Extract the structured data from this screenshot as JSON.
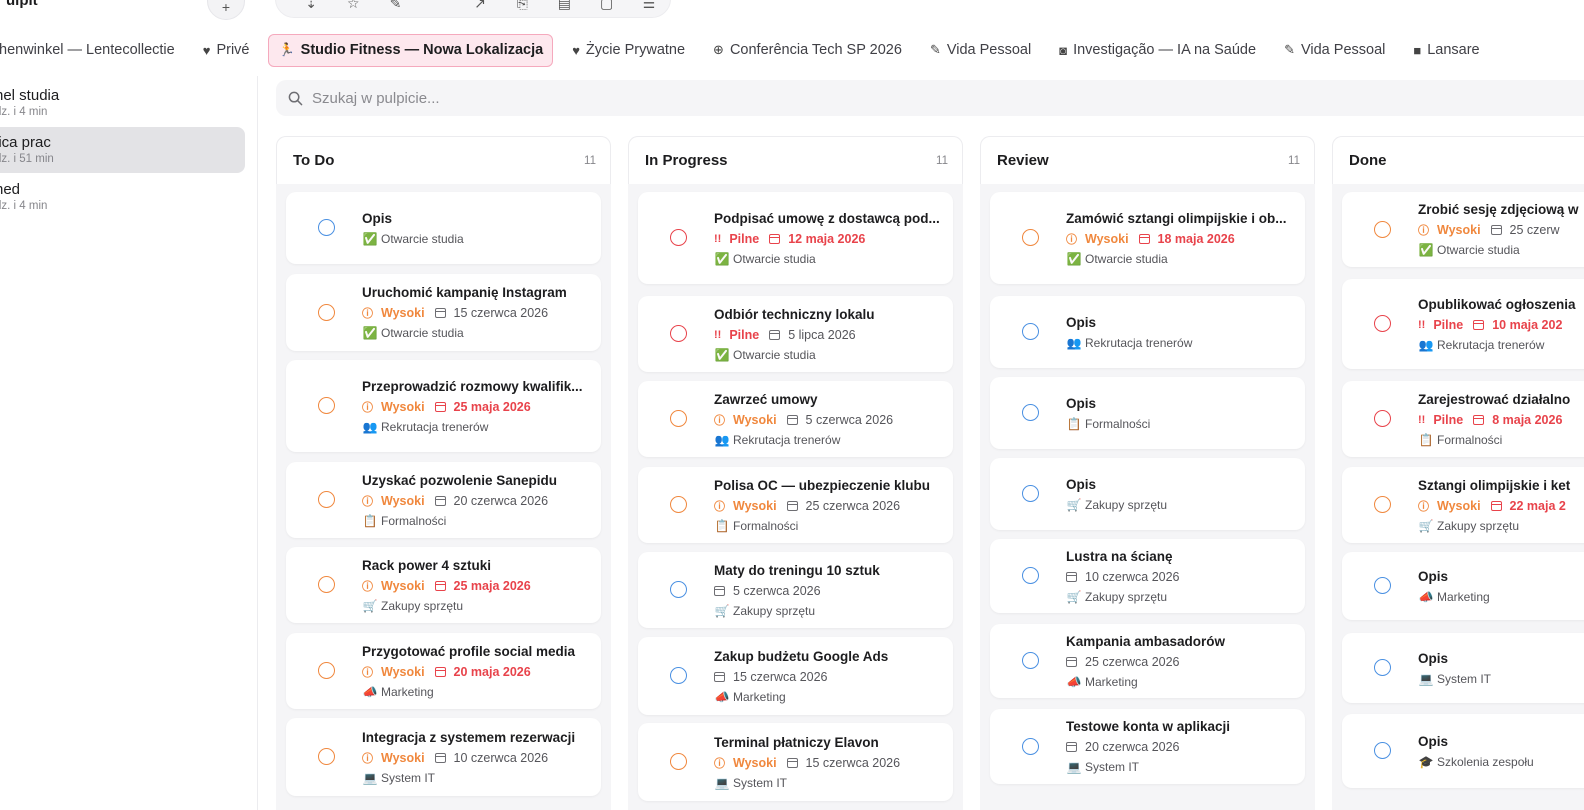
{
  "app": {
    "title": "ulpit"
  },
  "tabs": [
    {
      "label": "henwinkel — Lentecollectie",
      "icon": "none"
    },
    {
      "label": "Privé",
      "icon": "heart-icon"
    },
    {
      "label": "Studio Fitness — Nowa Lokalizacja",
      "icon": "runner-icon",
      "active": true
    },
    {
      "label": "Życie Prywatne",
      "icon": "heart-icon"
    },
    {
      "label": "Conferência Tech SP 2026",
      "icon": "globe-icon"
    },
    {
      "label": "Vida Pessoal",
      "icon": "pencil-icon"
    },
    {
      "label": "Investigação — IA na Saúde",
      "icon": "camera-icon"
    },
    {
      "label": "Vida Pessoal",
      "icon": "pencil-icon"
    },
    {
      "label": "Lansare",
      "icon": "bag-icon"
    }
  ],
  "sidebar": {
    "items": [
      {
        "title": "nel studia",
        "sub": "dz. i 4 min"
      },
      {
        "title": "lica prac",
        "sub": "dz. i 51 min",
        "active": true
      },
      {
        "title": "ned",
        "sub": "dz. i 4 min"
      }
    ]
  },
  "search": {
    "placeholder": "Szukaj w pulpicie..."
  },
  "columns": [
    {
      "title": "To Do",
      "count": "11",
      "cards": [
        {
          "title": "Opis",
          "status": "blue",
          "priority": "",
          "date": "",
          "date_red": false,
          "tag": "Otwarcie studia",
          "tag_icon": "✅"
        },
        {
          "title": "Uruchomić kampanię Instagram",
          "status": "orange",
          "priority": "Wysoki",
          "priority_level": "high",
          "date": "15 czerwca 2026",
          "date_red": false,
          "tag": "Otwarcie studia",
          "tag_icon": "✅"
        },
        {
          "title": "Przeprowadzić rozmowy kwalifik...",
          "status": "orange",
          "priority": "Wysoki",
          "priority_level": "high",
          "date": "25 maja 2026",
          "date_red": true,
          "tag": "Rekrutacja trenerów",
          "tag_icon": "👥"
        },
        {
          "title": "Uzyskać pozwolenie Sanepidu",
          "status": "orange",
          "priority": "Wysoki",
          "priority_level": "high",
          "date": "20 czerwca 2026",
          "date_red": false,
          "tag": "Formalności",
          "tag_icon": "📋"
        },
        {
          "title": "Rack power 4 sztuki",
          "status": "orange",
          "priority": "Wysoki",
          "priority_level": "high",
          "date": "25 maja 2026",
          "date_red": true,
          "tag": "Zakupy sprzętu",
          "tag_icon": "🛒"
        },
        {
          "title": "Przygotować profile social media",
          "status": "orange",
          "priority": "Wysoki",
          "priority_level": "high",
          "date": "20 maja 2026",
          "date_red": true,
          "tag": "Marketing",
          "tag_icon": "📣"
        },
        {
          "title": "Integracja z systemem rezerwacji",
          "status": "orange",
          "priority": "Wysoki",
          "priority_level": "high",
          "date": "10 czerwca 2026",
          "date_red": false,
          "tag": "System IT",
          "tag_icon": "💻"
        }
      ]
    },
    {
      "title": "In Progress",
      "count": "11",
      "cards": [
        {
          "title": "Podpisać umowę z dostawcą pod...",
          "status": "red",
          "priority": "Pilne",
          "priority_level": "urgent",
          "date": "12 maja 2026",
          "date_red": true,
          "tag": "Otwarcie studia",
          "tag_icon": "✅"
        },
        {
          "title": "Odbiór techniczny lokalu",
          "status": "red",
          "priority": "Pilne",
          "priority_level": "urgent",
          "date": "5 lipca 2026",
          "date_red": false,
          "tag": "Otwarcie studia",
          "tag_icon": "✅"
        },
        {
          "title": "Zawrzeć umowy",
          "status": "orange",
          "priority": "Wysoki",
          "priority_level": "high",
          "date": "5 czerwca 2026",
          "date_red": false,
          "tag": "Rekrutacja trenerów",
          "tag_icon": "👥"
        },
        {
          "title": "Polisa OC — ubezpieczenie klubu",
          "status": "orange",
          "priority": "Wysoki",
          "priority_level": "high",
          "date": "25 czerwca 2026",
          "date_red": false,
          "tag": "Formalności",
          "tag_icon": "📋"
        },
        {
          "title": "Maty do treningu 10 sztuk",
          "status": "blue",
          "priority": "",
          "date": "5 czerwca 2026",
          "date_red": false,
          "tag": "Zakupy sprzętu",
          "tag_icon": "🛒"
        },
        {
          "title": "Zakup budżetu Google Ads",
          "status": "blue",
          "priority": "",
          "date": "15 czerwca 2026",
          "date_red": false,
          "tag": "Marketing",
          "tag_icon": "📣"
        },
        {
          "title": "Terminal płatniczy Elavon",
          "status": "orange",
          "priority": "Wysoki",
          "priority_level": "high",
          "date": "15 czerwca 2026",
          "date_red": false,
          "tag": "System IT",
          "tag_icon": "💻"
        }
      ]
    },
    {
      "title": "Review",
      "count": "11",
      "cards": [
        {
          "title": "Zamówić sztangi olimpijskie i ob...",
          "status": "orange",
          "priority": "Wysoki",
          "priority_level": "high",
          "date": "18 maja 2026",
          "date_red": true,
          "tag": "Otwarcie studia",
          "tag_icon": "✅"
        },
        {
          "title": "Opis",
          "status": "blue",
          "priority": "",
          "date": "",
          "date_red": false,
          "tag": "Rekrutacja trenerów",
          "tag_icon": "👥"
        },
        {
          "title": "Opis",
          "status": "blue",
          "priority": "",
          "date": "",
          "date_red": false,
          "tag": "Formalności",
          "tag_icon": "📋"
        },
        {
          "title": "Opis",
          "status": "blue",
          "priority": "",
          "date": "",
          "date_red": false,
          "tag": "Zakupy sprzętu",
          "tag_icon": "🛒"
        },
        {
          "title": "Lustra na ścianę",
          "status": "blue",
          "priority": "",
          "date": "10 czerwca 2026",
          "date_red": false,
          "tag": "Zakupy sprzętu",
          "tag_icon": "🛒"
        },
        {
          "title": "Kampania ambasadorów",
          "status": "blue",
          "priority": "",
          "date": "25 czerwca 2026",
          "date_red": false,
          "tag": "Marketing",
          "tag_icon": "📣"
        },
        {
          "title": "Testowe konta w aplikacji",
          "status": "blue",
          "priority": "",
          "date": "20 czerwca 2026",
          "date_red": false,
          "tag": "System IT",
          "tag_icon": "💻"
        }
      ]
    },
    {
      "title": "Done",
      "count": "",
      "cards": [
        {
          "title": "Zrobić sesję zdjęciową w",
          "status": "orange",
          "priority": "Wysoki",
          "priority_level": "high",
          "date": "25 czerw",
          "date_red": false,
          "tag": "Otwarcie studia",
          "tag_icon": "✅"
        },
        {
          "title": "Opublikować ogłoszenia",
          "status": "red",
          "priority": "Pilne",
          "priority_level": "urgent",
          "date": "10 maja 202",
          "date_red": true,
          "tag": "Rekrutacja trenerów",
          "tag_icon": "👥"
        },
        {
          "title": "Zarejestrować działalno",
          "status": "red",
          "priority": "Pilne",
          "priority_level": "urgent",
          "date": "8 maja 2026",
          "date_red": true,
          "tag": "Formalności",
          "tag_icon": "📋"
        },
        {
          "title": "Sztangi olimpijskie i ket",
          "status": "orange",
          "priority": "Wysoki",
          "priority_level": "high",
          "date": "22 maja 2",
          "date_red": true,
          "tag": "Zakupy sprzętu",
          "tag_icon": "🛒"
        },
        {
          "title": "Opis",
          "status": "blue",
          "priority": "",
          "date": "",
          "date_red": false,
          "tag": "Marketing",
          "tag_icon": "📣"
        },
        {
          "title": "Opis",
          "status": "blue",
          "priority": "",
          "date": "",
          "date_red": false,
          "tag": "System IT",
          "tag_icon": "💻"
        },
        {
          "title": "Opis",
          "status": "blue",
          "priority": "",
          "date": "",
          "date_red": false,
          "tag": "Szkolenia zespołu",
          "tag_icon": "🎓"
        }
      ]
    }
  ],
  "colors": {
    "accent": "#e8336b",
    "high": "#f0883e",
    "urgent": "#e8434b",
    "todo_ring": "#4a90e2"
  }
}
